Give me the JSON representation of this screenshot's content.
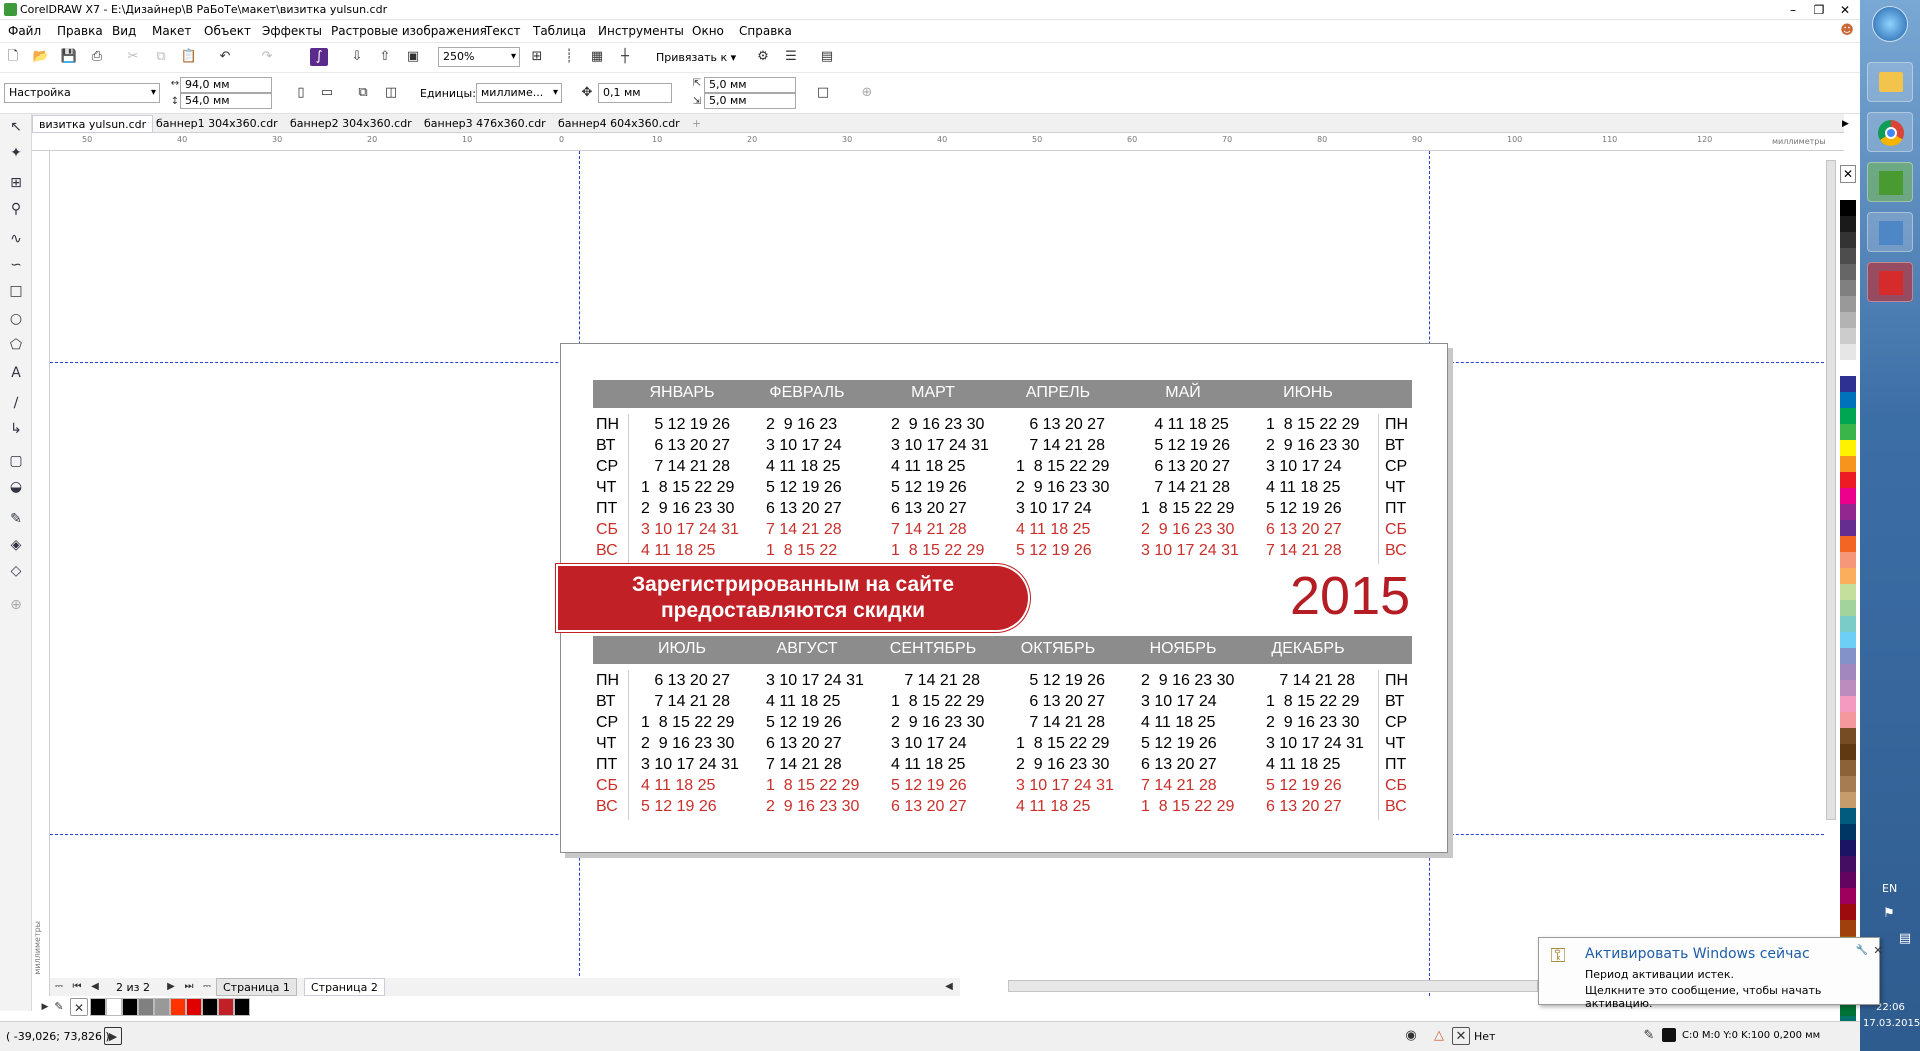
{
  "window": {
    "title": "CorelDRAW X7 - E:\\Дизайнер\\В РаБоТе\\макет\\визитка yulsun.cdr"
  },
  "menu": [
    "Файл",
    "Правка",
    "Вид",
    "Макет",
    "Объект",
    "Эффекты",
    "Растровые изображения",
    "Текст",
    "Таблица",
    "Инструменты",
    "Окно",
    "Справка"
  ],
  "toolbar": {
    "zoom": "250%",
    "snap": "Привязать к"
  },
  "propbar": {
    "preset": "Настройка",
    "width": "94,0 мм",
    "height": "54,0 мм",
    "units_label": "Единицы:",
    "units": "миллиме...",
    "nudge": "0,1 мм",
    "dup_x": "5,0 мм",
    "dup_y": "5,0 мм"
  },
  "tabs": [
    "визитка yulsun.cdr",
    "баннер1 304x360.cdr",
    "баннер2 304x360.cdr",
    "баннер3 476x360.cdr",
    "баннер4 604x360.cdr"
  ],
  "ruler": {
    "h_ticks": [
      "50",
      "40",
      "30",
      "20",
      "10",
      "0",
      "10",
      "20",
      "30",
      "40",
      "50",
      "60",
      "70",
      "80",
      "90",
      "100",
      "110",
      "120"
    ],
    "unit": "миллиметры",
    "v_unit": "миллиметры"
  },
  "calendar": {
    "days": [
      "ПН",
      "ВТ",
      "СР",
      "ЧТ",
      "ПТ",
      "СБ",
      "ВС"
    ],
    "year": "2015",
    "banner": [
      "Зарегистрированным на сайте",
      "предоставляются скидки"
    ],
    "top_months": [
      {
        "name": "ЯНВАРЬ",
        "rows": [
          "   5 12 19 26",
          "   6 13 20 27",
          "   7 14 21 28",
          "1  8 15 22 29",
          "2  9 16 23 30",
          "3 10 17 24 31",
          "4 11 18 25"
        ]
      },
      {
        "name": "ФЕВРАЛЬ",
        "rows": [
          "2  9 16 23",
          "3 10 17 24",
          "4 11 18 25",
          "5 12 19 26",
          "6 13 20 27",
          "7 14 21 28",
          "1  8 15 22"
        ]
      },
      {
        "name": "МАРТ",
        "rows": [
          "2  9 16 23 30",
          "3 10 17 24 31",
          "4 11 18 25",
          "5 12 19 26",
          "6 13 20 27",
          "7 14 21 28",
          "1  8 15 22 29"
        ]
      },
      {
        "name": "АПРЕЛЬ",
        "rows": [
          "   6 13 20 27",
          "   7 14 21 28",
          "1  8 15 22 29",
          "2  9 16 23 30",
          "3 10 17 24",
          "4 11 18 25",
          "5 12 19 26"
        ]
      },
      {
        "name": "МАЙ",
        "rows": [
          "   4 11 18 25",
          "   5 12 19 26",
          "   6 13 20 27",
          "   7 14 21 28",
          "1  8 15 22 29",
          "2  9 16 23 30",
          "3 10 17 24 31"
        ]
      },
      {
        "name": "ИЮНЬ",
        "rows": [
          "1  8 15 22 29",
          "2  9 16 23 30",
          "3 10 17 24",
          "4 11 18 25",
          "5 12 19 26",
          "6 13 20 27",
          "7 14 21 28"
        ]
      }
    ],
    "bottom_months": [
      {
        "name": "ИЮЛЬ",
        "rows": [
          "   6 13 20 27",
          "   7 14 21 28",
          "1  8 15 22 29",
          "2  9 16 23 30",
          "3 10 17 24 31",
          "4 11 18 25",
          "5 12 19 26"
        ]
      },
      {
        "name": "АВГУСТ",
        "rows": [
          "3 10 17 24 31",
          "4 11 18 25",
          "5 12 19 26",
          "6 13 20 27",
          "7 14 21 28",
          "1  8 15 22 29",
          "2  9 16 23 30"
        ]
      },
      {
        "name": "СЕНТЯБРЬ",
        "rows": [
          "   7 14 21 28",
          "1  8 15 22 29",
          "2  9 16 23 30",
          "3 10 17 24",
          "4 11 18 25",
          "5 12 19 26",
          "6 13 20 27"
        ]
      },
      {
        "name": "ОКТЯБРЬ",
        "rows": [
          "   5 12 19 26",
          "   6 13 20 27",
          "   7 14 21 28",
          "1  8 15 22 29",
          "2  9 16 23 30",
          "3 10 17 24 31",
          "4 11 18 25"
        ]
      },
      {
        "name": "НОЯБРЬ",
        "rows": [
          "2  9 16 23 30",
          "3 10 17 24",
          "4 11 18 25",
          "5 12 19 26",
          "6 13 20 27",
          "7 14 21 28",
          "1  8 15 22 29"
        ]
      },
      {
        "name": "ДЕКАБРЬ",
        "rows": [
          "   7 14 21 28",
          "1  8 15 22 29",
          "2  9 16 23 30",
          "3 10 17 24 31",
          "4 11 18 25",
          "5 12 19 26",
          "6 13 20 27"
        ]
      }
    ]
  },
  "pages": {
    "counter": "2 из 2",
    "tabs": [
      "Страница 1",
      "Страница 2"
    ]
  },
  "status": {
    "coords": "( -39,026; 73,826 )",
    "fill": "Нет",
    "outline": "C:0 M:0 Y:0 K:100  0,200 мм"
  },
  "notification": {
    "title": "Активировать Windows сейчас",
    "line1": "Период активации истек.",
    "line2": "Щелкните это сообщение, чтобы начать активацию."
  },
  "tray": {
    "lang": "EN",
    "time": "22:06",
    "date": "17.03.2015"
  },
  "colors": {
    "accent_red": "#c02026",
    "month_bar": "#8c8c8c",
    "guide": "#2a3fd6"
  },
  "palette": [
    "#ffffff",
    "#000000",
    "#1a1a1a",
    "#333333",
    "#4d4d4d",
    "#666666",
    "#808080",
    "#999999",
    "#b3b3b3",
    "#cccccc",
    "#e6e6e6",
    "#ffffff",
    "#2e3192",
    "#0072bc",
    "#00a651",
    "#39b54a",
    "#fff200",
    "#f7941d",
    "#ed1c24",
    "#ec008c",
    "#92278f",
    "#662d91",
    "#f26522",
    "#f7977a",
    "#fbaf5d",
    "#c4df9b",
    "#a3d39c",
    "#7accc8",
    "#6dcff6",
    "#8393ca",
    "#a187be",
    "#bd8cbf",
    "#f49ac1",
    "#f5989d",
    "#754c24",
    "#603913",
    "#8c6239",
    "#a67c52",
    "#c69c6d",
    "#005b7f",
    "#003663",
    "#1b1464",
    "#440e62",
    "#630460",
    "#9e005d",
    "#9e0b0f",
    "#a0410d",
    "#a36209",
    "#aba000",
    "#598527",
    "#197b30",
    "#007236",
    "#00746b",
    "#0076a3",
    "#004a80",
    "#003471"
  ],
  "doc_palette": [
    "#000000",
    "#ffffff",
    "#000000",
    "#808080",
    "#999999",
    "#ff3300",
    "#e00000",
    "#000000",
    "#c02026",
    "#000000"
  ]
}
